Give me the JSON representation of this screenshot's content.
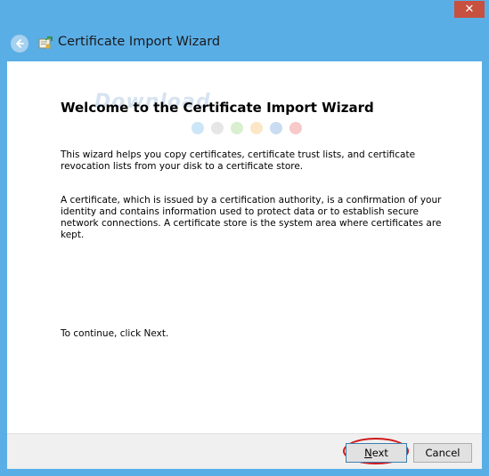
{
  "window": {
    "title": "Certificate Import Wizard",
    "close_icon": "close-icon",
    "back_icon": "back-arrow-icon",
    "app_icon": "certificate-icon"
  },
  "content": {
    "heading": "Welcome to the Certificate Import Wizard",
    "paragraph1": "This wizard helps you copy certificates, certificate trust lists, and certificate revocation lists from your disk to a certificate store.",
    "paragraph2": "A certificate, which is issued by a certification authority, is a confirmation of your identity and contains information used to protect data or to establish secure network connections. A certificate store is the system area where certificates are kept.",
    "paragraph3": "To continue, click Next.",
    "watermark": "Download",
    "watermark_dot_colors": [
      "#cde6f7",
      "#e6e6e6",
      "#d8efd0",
      "#fbe7c8",
      "#c9dcf2",
      "#f7c9c9"
    ]
  },
  "footer": {
    "next_label_first": "N",
    "next_label_rest": "ext",
    "cancel_label": "Cancel"
  },
  "colors": {
    "frame": "#5aaee6",
    "close_button": "#c7503f",
    "highlight_ring": "#d0191a"
  }
}
